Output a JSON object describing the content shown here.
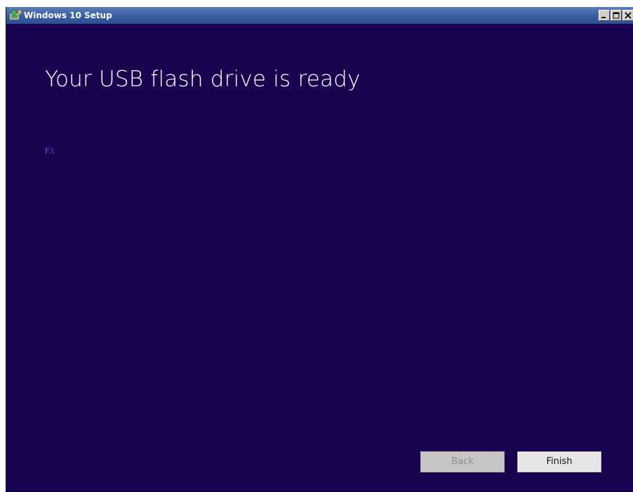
{
  "window": {
    "title": "Windows 10 Setup",
    "icon": "setup-app-icon",
    "controls": {
      "minimize_icon": "minimize-icon",
      "maximize_icon": "maximize-icon",
      "close_icon": "close-icon"
    }
  },
  "page": {
    "heading": "Your USB flash drive is ready",
    "drive_path": "F:\\"
  },
  "buttons": {
    "back_label": "Back",
    "back_enabled": false,
    "finish_label": "Finish"
  },
  "colors": {
    "background": "#1a0350",
    "heading": "#ffffff",
    "drive_path": "#5b5cf0",
    "title_bar": "#3d62a6"
  }
}
